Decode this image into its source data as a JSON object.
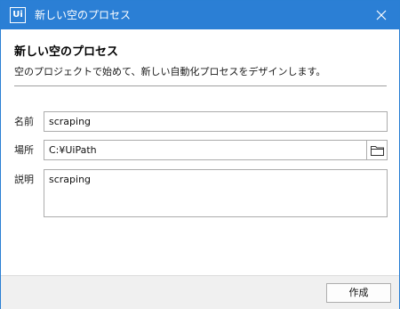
{
  "window": {
    "title": "新しい空のプロセス",
    "logo_text": "Ui"
  },
  "header": {
    "title": "新しい空のプロセス",
    "description": "空のプロジェクトで始めて、新しい自動化プロセスをデザインします。"
  },
  "form": {
    "name": {
      "label": "名前",
      "value": "scraping"
    },
    "location": {
      "label": "場所",
      "value": "C:¥UiPath"
    },
    "description": {
      "label": "説明",
      "value": "scraping"
    }
  },
  "footer": {
    "create_label": "作成"
  },
  "icons": {
    "close": "close-icon",
    "folder": "folder-icon",
    "logo": "uipath-logo-icon"
  },
  "colors": {
    "titlebar": "#2b7fd5",
    "footer": "#f0f0f0"
  }
}
